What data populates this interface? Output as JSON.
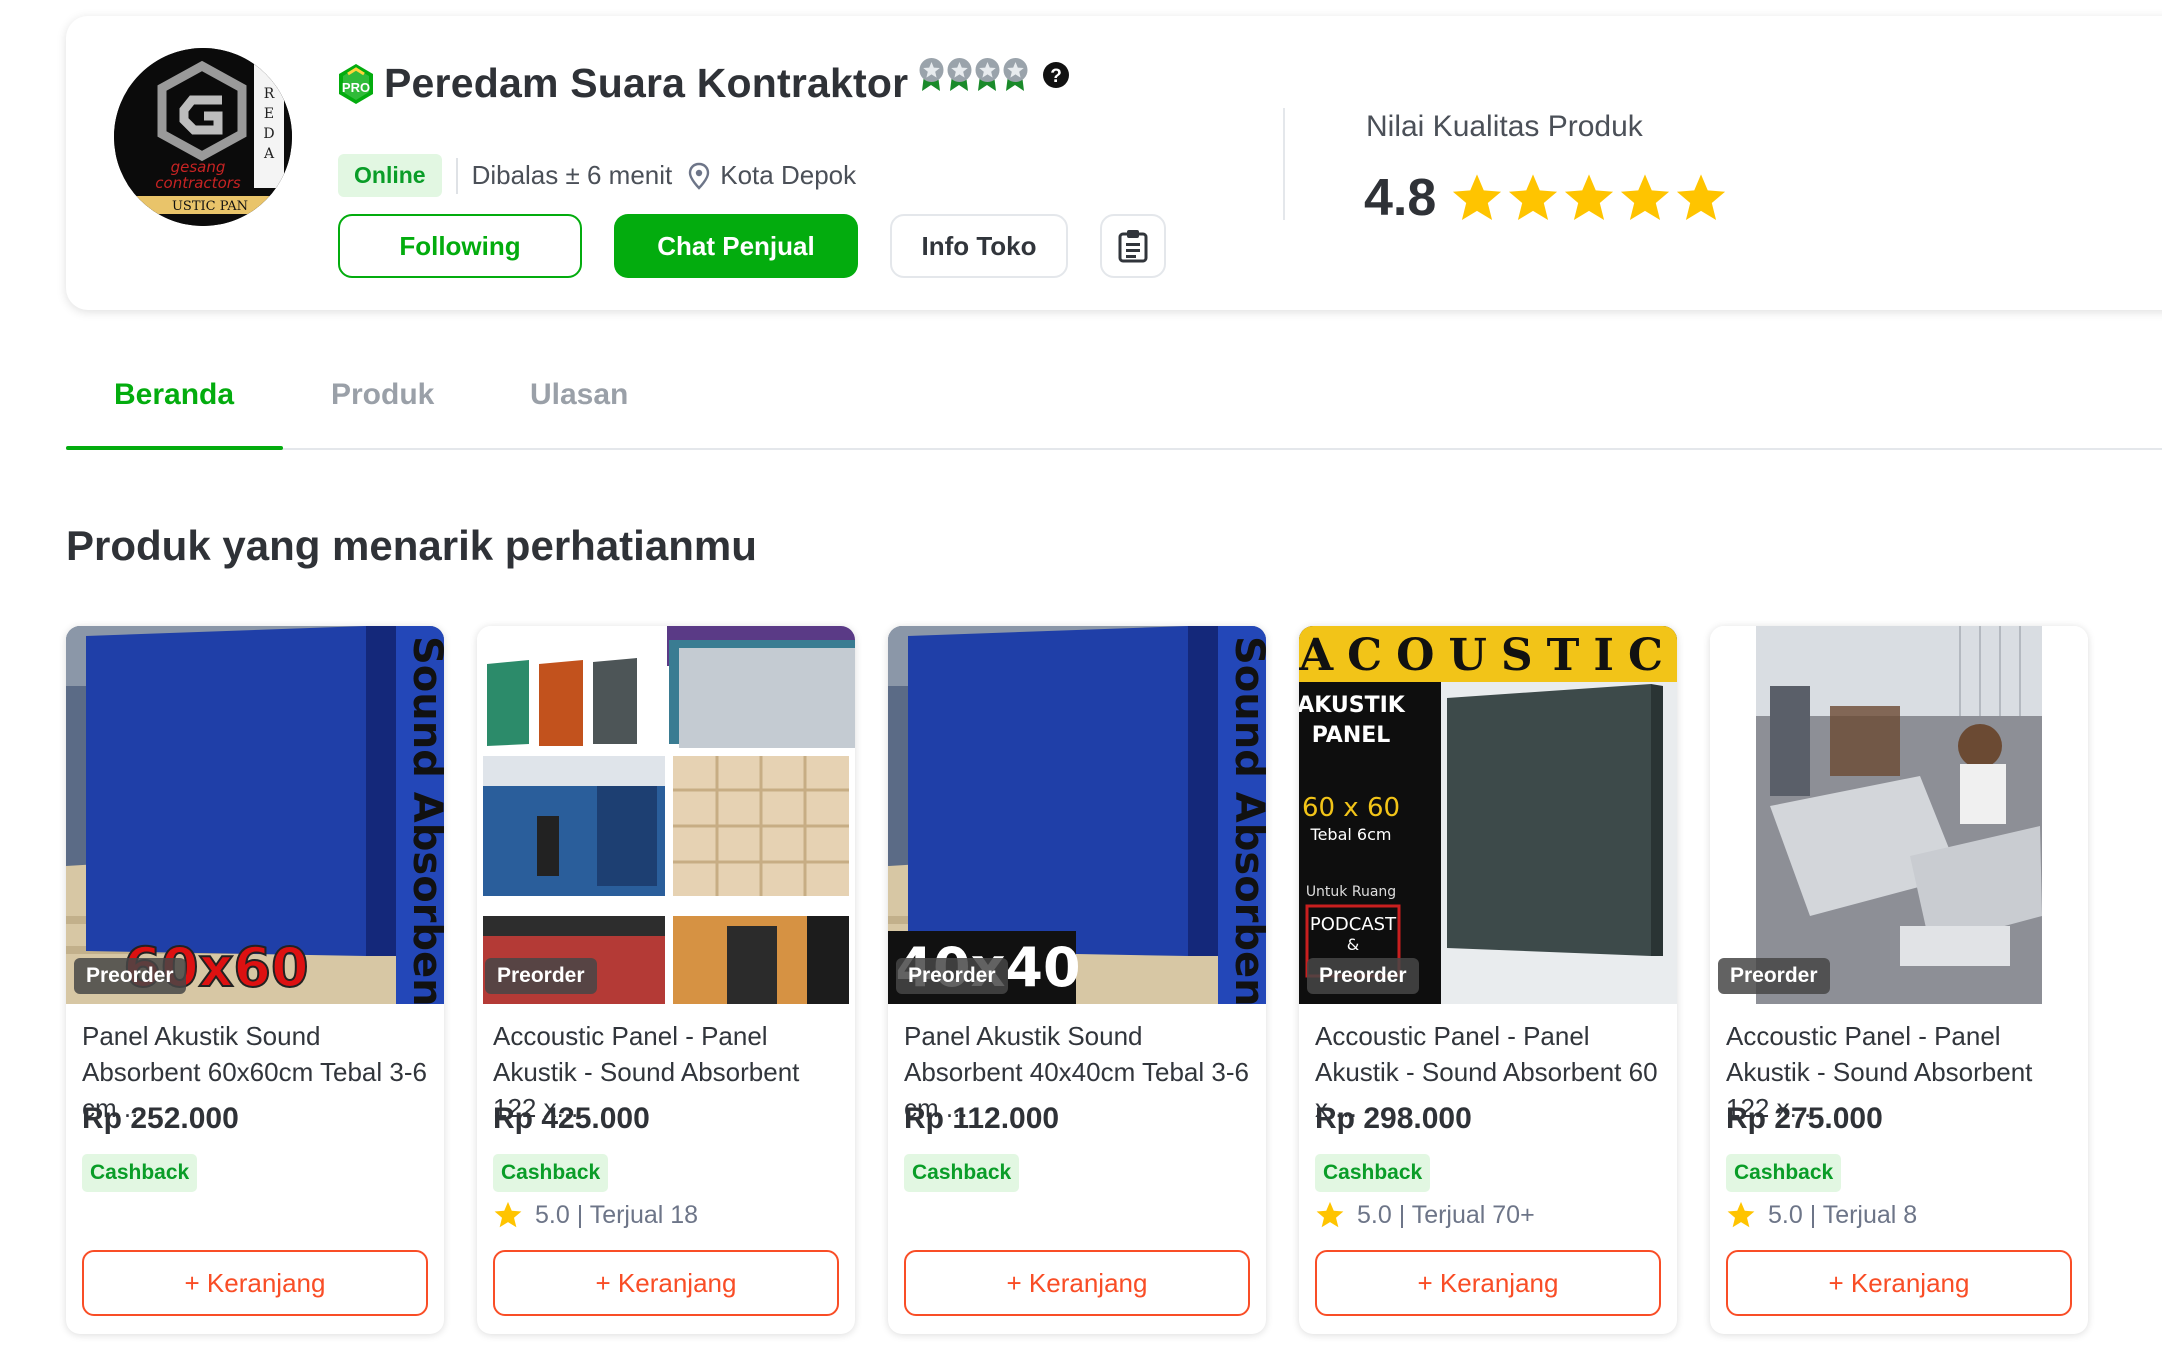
{
  "shop": {
    "name": "Peredam Suara Kontraktor",
    "badge_icon": "pro-merchant-badge",
    "medal_icon": "shop-tier-medal",
    "medal_count": 4,
    "status": "Online",
    "response_time": "Dibalas ± 6 menit",
    "location": "Kota Depok",
    "logo_icon": "shop-logo"
  },
  "actions": {
    "following_label": "Following",
    "chat_label": "Chat Penjual",
    "info_label": "Info Toko",
    "note_icon": "clipboard-icon"
  },
  "quality": {
    "label": "Nilai Kualitas Produk",
    "value": "4.8",
    "stars": 5
  },
  "tabs": [
    {
      "label": "Beranda",
      "active": true
    },
    {
      "label": "Produk",
      "active": false
    },
    {
      "label": "Ulasan",
      "active": false
    }
  ],
  "section_title": "Produk yang menarik perhatianmu",
  "products": [
    {
      "name": "Panel Akustik Sound Absorbent 60x60cm Tebal 3-6 cm ...",
      "price": "Rp 252.000",
      "cashback": "Cashback",
      "rating": "",
      "badge": "Preorder",
      "cart_label": "+ Keranjang",
      "image_text": "60x60",
      "image_side_text": "Sound Absorbent"
    },
    {
      "name": "Accoustic Panel - Panel Akustik - Sound Absorbent 122 x...",
      "price": "Rp 425.000",
      "cashback": "Cashback",
      "rating": "5.0 | Terjual 18",
      "badge": "Preorder",
      "cart_label": "+ Keranjang"
    },
    {
      "name": "Panel Akustik Sound Absorbent 40x40cm Tebal 3-6 cm ...",
      "price": "Rp 112.000",
      "cashback": "Cashback",
      "rating": "",
      "badge": "Preorder",
      "cart_label": "+ Keranjang",
      "image_text": "40x40",
      "image_side_text": "Sound Absorbent"
    },
    {
      "name": "Accoustic Panel - Panel Akustik - Sound Absorbent 60 x ...",
      "price": "Rp 298.000",
      "cashback": "Cashback",
      "rating": "5.0 | Terjual 70+",
      "badge": "Preorder",
      "cart_label": "+ Keranjang",
      "image_text": "ACOUSTIC",
      "image_labels": [
        "AKUSTIK",
        "PANEL",
        "60 x 60",
        "Tebal 6cm",
        "Untuk Ruang",
        "PODCAST",
        "&"
      ]
    },
    {
      "name": "Accoustic Panel - Panel Akustik - Sound Absorbent 122 x...",
      "price": "Rp 275.000",
      "cashback": "Cashback",
      "rating": "5.0 | Terjual 8",
      "badge": "Preorder",
      "cart_label": "+ Keranjang"
    }
  ],
  "colors": {
    "brand_green": "#03ac0e",
    "cart_orange": "#f94d26",
    "star_yellow": "#ffc400",
    "text_dark": "#2f3237"
  }
}
